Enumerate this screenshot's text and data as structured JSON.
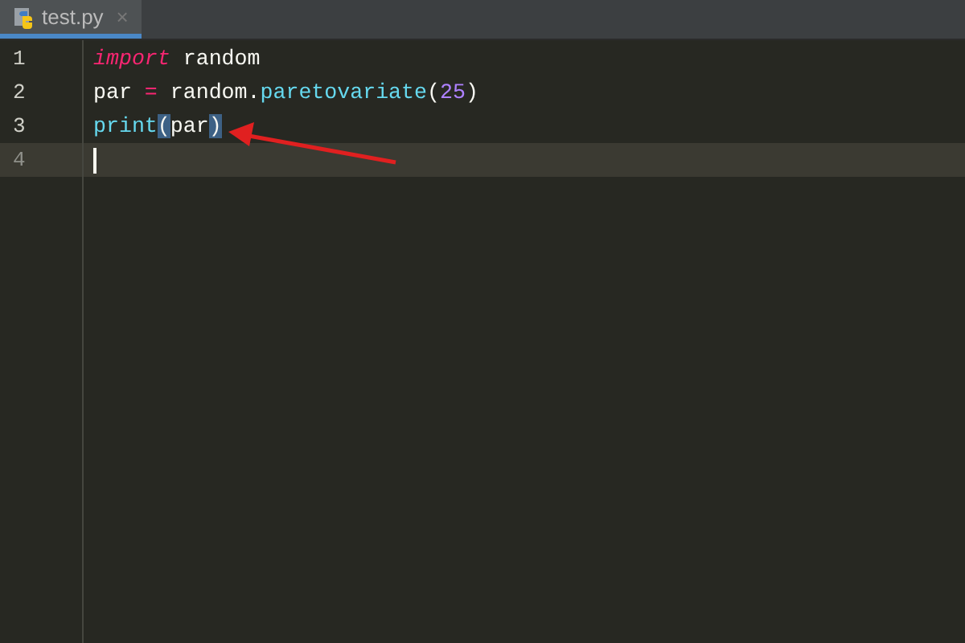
{
  "tabs": [
    {
      "label": "test.py",
      "close": "×",
      "selected": true
    }
  ],
  "lines": [
    {
      "number": "1",
      "current": false,
      "tokens": [
        {
          "kind": "keyword",
          "text": "import"
        },
        {
          "kind": "plain",
          "text": " random"
        }
      ]
    },
    {
      "number": "2",
      "current": false,
      "tokens": [
        {
          "kind": "plain",
          "text": "par "
        },
        {
          "kind": "operator",
          "text": "="
        },
        {
          "kind": "plain",
          "text": " random."
        },
        {
          "kind": "function",
          "text": "paretovariate"
        },
        {
          "kind": "plain",
          "text": "("
        },
        {
          "kind": "number",
          "text": "25"
        },
        {
          "kind": "plain",
          "text": ")"
        }
      ]
    },
    {
      "number": "3",
      "current": false,
      "tokens": [
        {
          "kind": "function",
          "text": "print"
        },
        {
          "kind": "match",
          "text": "("
        },
        {
          "kind": "plain",
          "text": "par"
        },
        {
          "kind": "match",
          "text": ")"
        }
      ]
    },
    {
      "number": "4",
      "current": true
    }
  ]
}
